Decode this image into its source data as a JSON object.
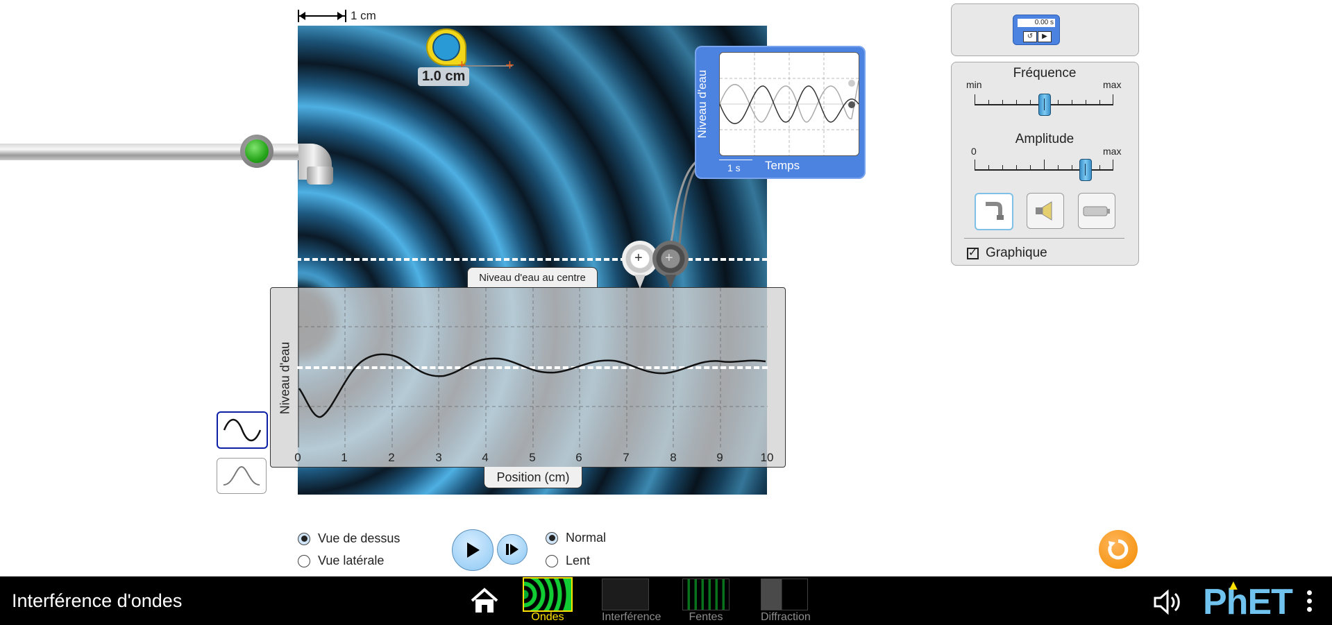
{
  "scale": {
    "label": "1 cm"
  },
  "tape": {
    "label": "1.0 cm"
  },
  "probe_chart": {
    "ylabel": "Niveau d'eau",
    "xlabel": "Temps",
    "scale_label": "1 s"
  },
  "graph": {
    "title": "Niveau d'eau au centre",
    "ylabel": "Niveau d'eau",
    "xlabel": "Position (cm)",
    "x_ticks": [
      "0",
      "1",
      "2",
      "3",
      "4",
      "5",
      "6",
      "7",
      "8",
      "9",
      "10"
    ]
  },
  "view": {
    "top_label": "Vue de dessus",
    "side_label": "Vue latérale",
    "selected": "top"
  },
  "speed": {
    "normal_label": "Normal",
    "slow_label": "Lent",
    "selected": "normal"
  },
  "timer": {
    "display": "0.00 s"
  },
  "controls": {
    "frequency": {
      "title": "Fréquence",
      "min_label": "min",
      "max_label": "max",
      "value": 0.5
    },
    "amplitude": {
      "title": "Amplitude",
      "min_label": "0",
      "max_label": "max",
      "value": 0.8
    },
    "sources": [
      "water-faucet-icon",
      "speaker-icon",
      "laser-icon"
    ],
    "selected_source": "water",
    "graph_checkbox_label": "Graphique",
    "graph_checked": true
  },
  "navbar": {
    "title": "Interférence d'ondes",
    "tabs": [
      {
        "label": "Ondes",
        "selected": true
      },
      {
        "label": "Interférence",
        "selected": false
      },
      {
        "label": "Fentes",
        "selected": false
      },
      {
        "label": "Diffraction",
        "selected": false
      }
    ],
    "logo": "PhET"
  },
  "colors": {
    "accent": "#4c82e0",
    "selected_tab": "#ffe100",
    "reset": "#f28c00",
    "water": "#4fb1e4"
  }
}
